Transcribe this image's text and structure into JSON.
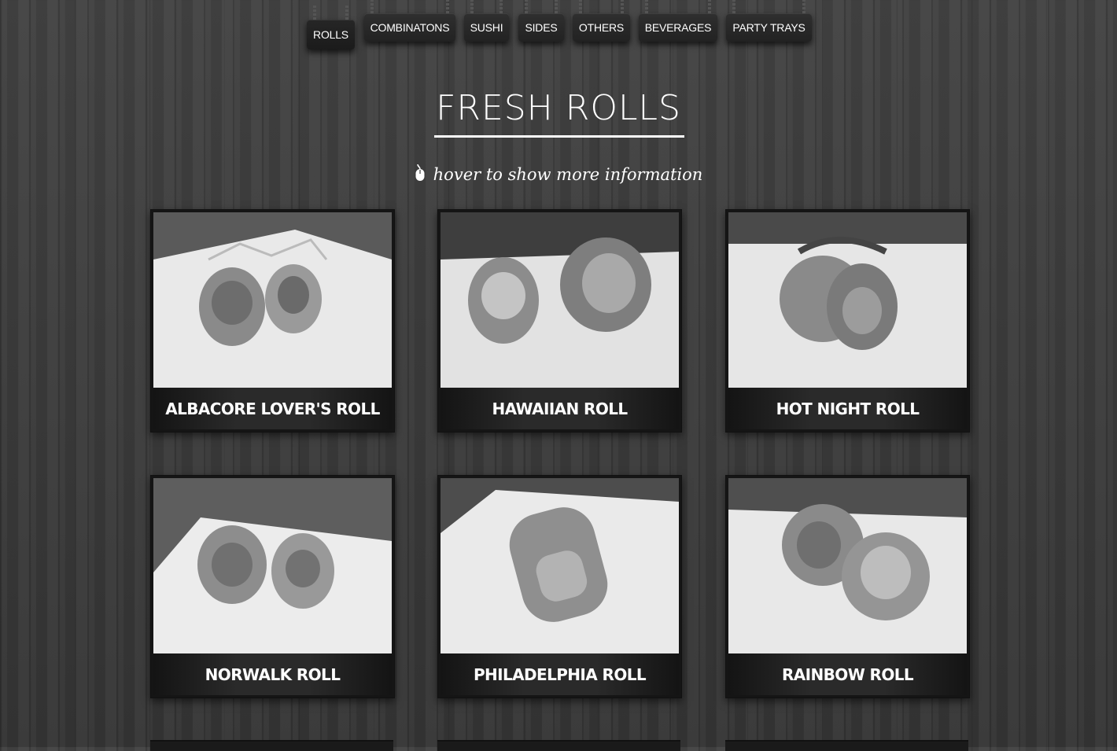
{
  "nav": {
    "items": [
      {
        "label": "ROLLS",
        "active": true
      },
      {
        "label": "COMBINATONS",
        "active": false
      },
      {
        "label": "SUSHI",
        "active": false
      },
      {
        "label": "SIDES",
        "active": false
      },
      {
        "label": "OTHERS",
        "active": false
      },
      {
        "label": "BEVERAGES",
        "active": false
      },
      {
        "label": "PARTY TRAYS",
        "active": false
      }
    ]
  },
  "section": {
    "title": "FRESH ROLLS",
    "hint": "hover to show more information",
    "hint_icon": "mouse-icon"
  },
  "menu_items": [
    {
      "name": "ALBACORE LOVER'S ROLL"
    },
    {
      "name": "HAWAIIAN ROLL"
    },
    {
      "name": "HOT NIGHT ROLL"
    },
    {
      "name": "NORWALK ROLL"
    },
    {
      "name": "PHILADELPHIA ROLL"
    },
    {
      "name": "RAINBOW ROLL"
    }
  ]
}
